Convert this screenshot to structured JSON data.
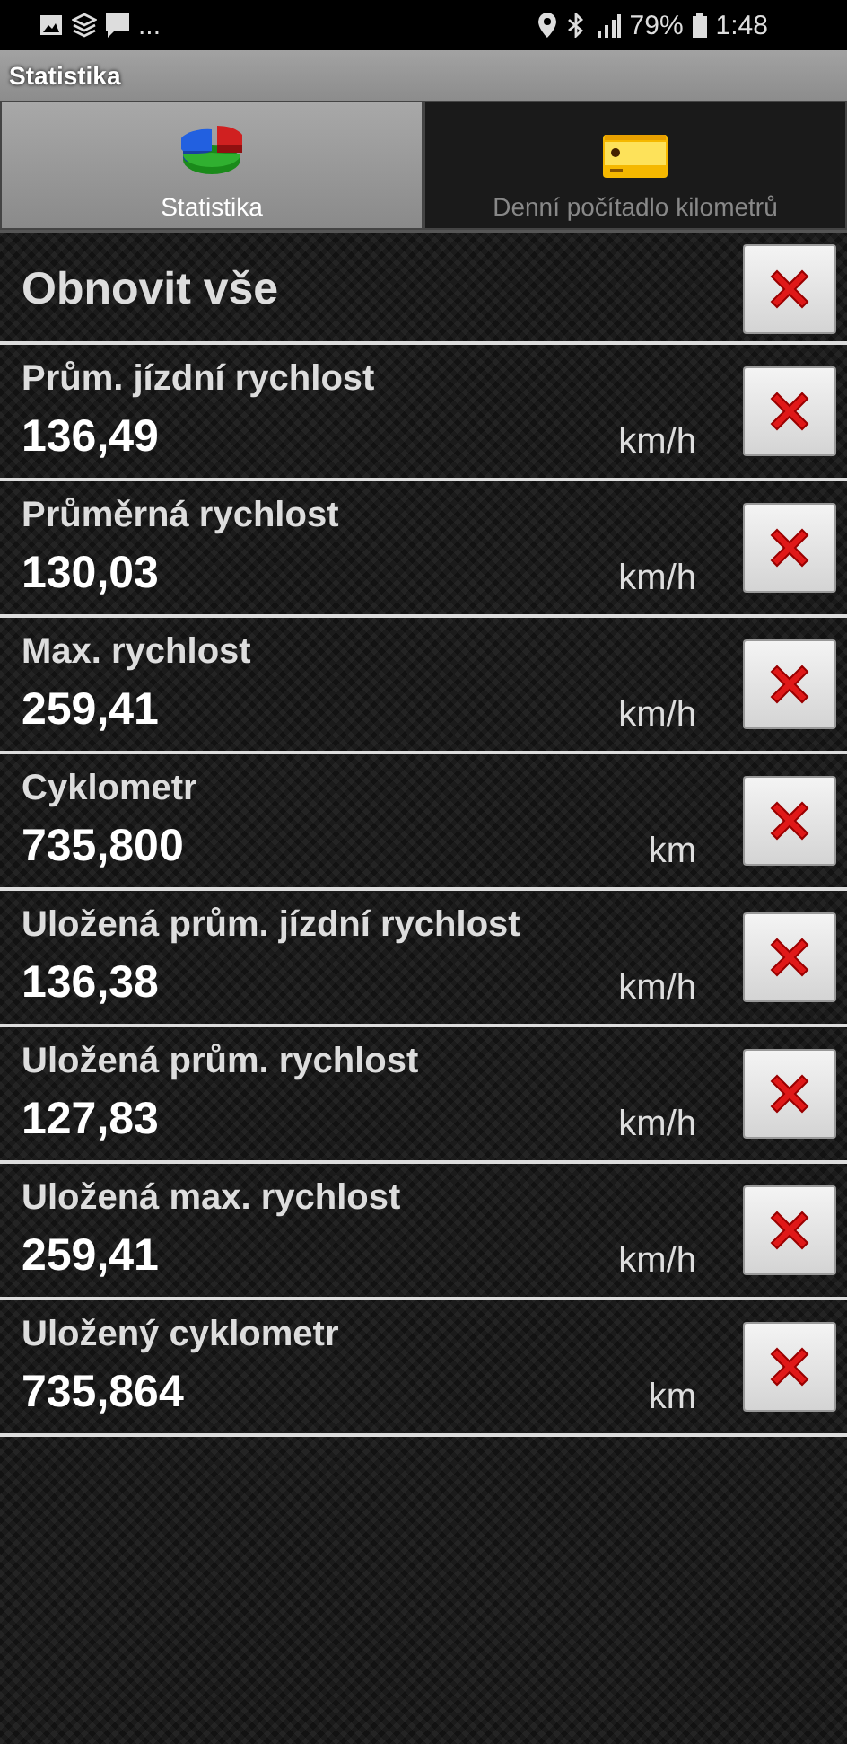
{
  "status_bar": {
    "more": "...",
    "battery": "79%",
    "time": "1:48"
  },
  "app_title": "Statistika",
  "tabs": [
    {
      "label": "Statistika",
      "selected": true
    },
    {
      "label": "Denní počítadlo kilometrů",
      "selected": false
    }
  ],
  "reset_all": {
    "label": "Obnovit vše"
  },
  "stats": [
    {
      "label": "Prům. jízdní rychlost",
      "value": "136,49",
      "unit": "km/h"
    },
    {
      "label": "Průměrná rychlost",
      "value": "130,03",
      "unit": "km/h"
    },
    {
      "label": "Max. rychlost",
      "value": "259,41",
      "unit": "km/h"
    },
    {
      "label": "Cyklometr",
      "value": "735,800",
      "unit": "km"
    },
    {
      "label": "Uložená prům. jízdní rychlost",
      "value": "136,38",
      "unit": "km/h"
    },
    {
      "label": "Uložená prům. rychlost",
      "value": "127,83",
      "unit": "km/h"
    },
    {
      "label": "Uložená max. rychlost",
      "value": "259,41",
      "unit": "km/h"
    },
    {
      "label": "Uložený cyklometr",
      "value": "735,864",
      "unit": "km"
    }
  ]
}
